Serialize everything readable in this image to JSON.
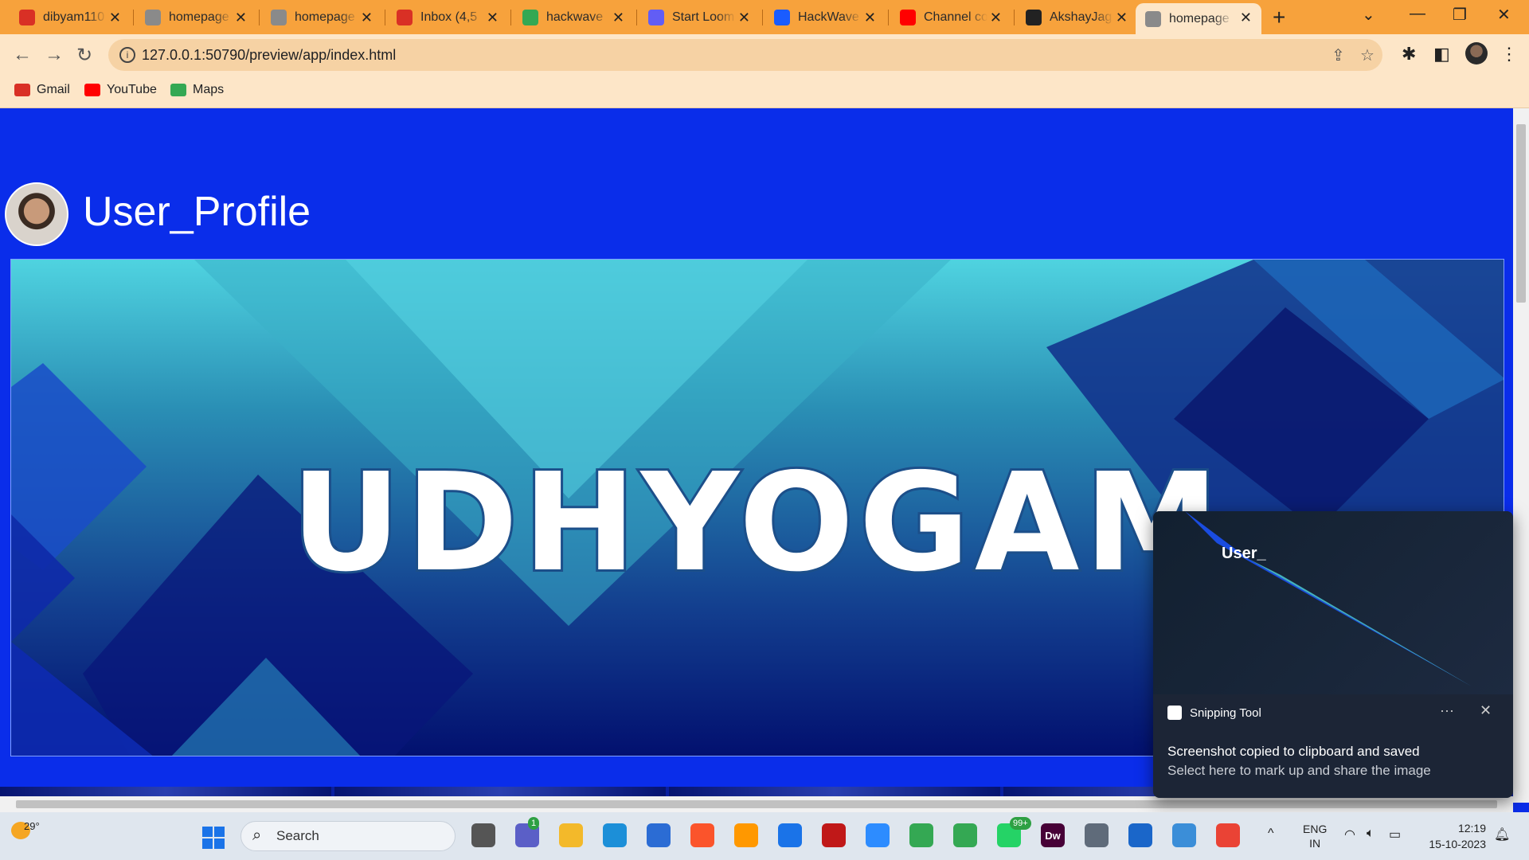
{
  "browser": {
    "tabs": [
      {
        "title": "dibyam110",
        "favicon": "gmail-icon",
        "color": "#d93025"
      },
      {
        "title": "homepage",
        "favicon": "globe-icon",
        "color": "#8a8a8a"
      },
      {
        "title": "homepage",
        "favicon": "globe-icon",
        "color": "#8a8a8a"
      },
      {
        "title": "Inbox (4,5",
        "favicon": "gmail-icon",
        "color": "#d93025"
      },
      {
        "title": "hackwave",
        "favicon": "drive-icon",
        "color": "#34a853"
      },
      {
        "title": "Start Loom",
        "favicon": "loom-icon",
        "color": "#625df5"
      },
      {
        "title": "HackWave",
        "favicon": "document-icon",
        "color": "#1a5cff"
      },
      {
        "title": "Channel co",
        "favicon": "youtube-icon",
        "color": "#ff0000"
      },
      {
        "title": "AkshayJag",
        "favicon": "github-icon",
        "color": "#222222"
      },
      {
        "title": "homepage",
        "favicon": "globe-icon",
        "color": "#8a8a8a",
        "active": true
      }
    ],
    "url": "127.0.0.1:50790/preview/app/index.html",
    "bookmarks": [
      {
        "label": "Gmail",
        "icon": "gmail-icon",
        "color": "#d93025"
      },
      {
        "label": "YouTube",
        "icon": "youtube-icon",
        "color": "#ff0000"
      },
      {
        "label": "Maps",
        "icon": "maps-icon",
        "color": "#34a853"
      }
    ]
  },
  "page": {
    "title": "User_Profile",
    "banner_text": "UDHYOGAM"
  },
  "notification": {
    "app": "Snipping Tool",
    "title": "Screenshot copied to clipboard and saved",
    "body": "Select here to mark up and share the image",
    "thumb_text": "User_"
  },
  "taskbar": {
    "weather_temp": "29°",
    "search_label": "Search",
    "apps": [
      {
        "name": "task-view-icon",
        "color": "#555"
      },
      {
        "name": "teams-icon",
        "color": "#5b5fc7",
        "badge": "1"
      },
      {
        "name": "file-explorer-icon",
        "color": "#f3b92a"
      },
      {
        "name": "edge-icon",
        "color": "#1c8fd8"
      },
      {
        "name": "store-icon",
        "color": "#2b6cd4"
      },
      {
        "name": "brave-icon",
        "color": "#fb542b"
      },
      {
        "name": "sublime-icon",
        "color": "#ff9800"
      },
      {
        "name": "help-icon",
        "color": "#1a73e8"
      },
      {
        "name": "mcafee-icon",
        "color": "#c01818"
      },
      {
        "name": "zoom-icon",
        "color": "#2d8cff"
      },
      {
        "name": "chrome-icon",
        "color": "#34a853"
      },
      {
        "name": "chrome-profile-icon",
        "color": "#34a853"
      },
      {
        "name": "whatsapp-icon",
        "color": "#25d366",
        "badge": "99+"
      },
      {
        "name": "dreamweaver-icon",
        "color": "#470137",
        "label": "Dw"
      },
      {
        "name": "settings-icon",
        "color": "#5f6b7a"
      },
      {
        "name": "defender-icon",
        "color": "#1a66c9"
      },
      {
        "name": "photos-icon",
        "color": "#3b8ed8"
      },
      {
        "name": "chrome-icon-2",
        "color": "#ea4335"
      }
    ],
    "lang_top": "ENG",
    "lang_bottom": "IN",
    "time": "12:19",
    "date": "15-10-2023"
  }
}
